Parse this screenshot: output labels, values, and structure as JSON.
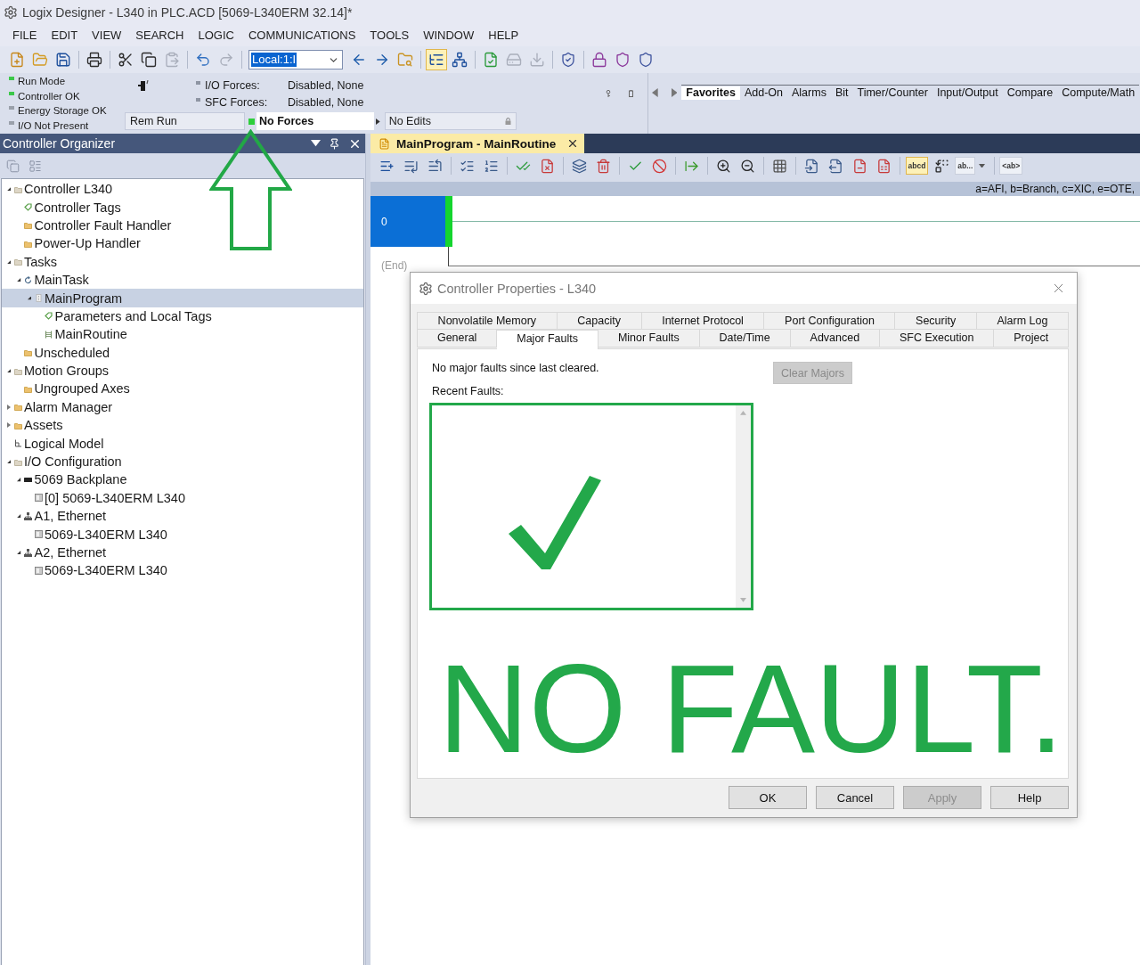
{
  "window": {
    "title": "Logix Designer - L340 in PLC.ACD [5069-L340ERM 32.14]*"
  },
  "menu": [
    "FILE",
    "EDIT",
    "VIEW",
    "SEARCH",
    "LOGIC",
    "COMMUNICATIONS",
    "TOOLS",
    "WINDOW",
    "HELP"
  ],
  "toolbar": {
    "items": [
      {
        "kind": "icon",
        "pressed": false,
        "disabled": false
      },
      {
        "kind": "icon",
        "pressed": false,
        "disabled": false
      },
      {
        "kind": "icon",
        "pressed": false,
        "disabled": false
      },
      {
        "kind": "separator"
      },
      {
        "kind": "icon",
        "pressed": false,
        "disabled": false
      },
      {
        "kind": "separator"
      },
      {
        "kind": "icon",
        "pressed": false,
        "disabled": false
      },
      {
        "kind": "icon",
        "pressed": false,
        "disabled": false
      },
      {
        "kind": "icon",
        "pressed": false,
        "disabled": true
      },
      {
        "kind": "separator"
      },
      {
        "kind": "icon",
        "pressed": false,
        "disabled": false
      },
      {
        "kind": "icon",
        "pressed": false,
        "disabled": true
      },
      {
        "kind": "separator"
      },
      {
        "kind": "field",
        "value": "Local:1:I",
        "text_selected": true
      },
      {
        "kind": "icon",
        "pressed": false,
        "disabled": false
      },
      {
        "kind": "icon",
        "pressed": false,
        "disabled": false
      },
      {
        "kind": "icon",
        "pressed": false,
        "disabled": false
      },
      {
        "kind": "separator"
      },
      {
        "kind": "icon",
        "pressed": true,
        "disabled": false
      },
      {
        "kind": "icon",
        "pressed": false,
        "disabled": false
      },
      {
        "kind": "separator"
      },
      {
        "kind": "icon",
        "pressed": false,
        "disabled": false
      },
      {
        "kind": "icon",
        "pressed": false,
        "disabled": true
      },
      {
        "kind": "icon",
        "pressed": false,
        "disabled": true
      },
      {
        "kind": "separator"
      },
      {
        "kind": "icon",
        "pressed": false,
        "disabled": false
      },
      {
        "kind": "separator"
      },
      {
        "kind": "icon",
        "pressed": false,
        "disabled": false
      },
      {
        "kind": "icon",
        "pressed": false,
        "disabled": false
      },
      {
        "kind": "icon",
        "pressed": false,
        "disabled": false
      }
    ]
  },
  "status": {
    "indicators": [
      {
        "label": "Run Mode",
        "color": "#3cc84a"
      },
      {
        "label": "Controller OK",
        "color": "#3cc84a"
      },
      {
        "label": "Energy Storage OK",
        "color": "#9aa0aa"
      },
      {
        "label": "I/O Not Present",
        "color": "#9aa0aa"
      }
    ],
    "forces": [
      {
        "label": "I/O Forces:",
        "value": "Disabled, None"
      },
      {
        "label": "SFC Forces:",
        "value": "Disabled, None"
      }
    ],
    "mode": "Rem Run",
    "forces_status": "No Forces",
    "edits_status": "No Edits"
  },
  "palette": {
    "tabs": [
      {
        "label": "Favorites",
        "selected": true
      },
      {
        "label": "Add-On",
        "selected": false
      },
      {
        "label": "Alarms",
        "selected": false
      },
      {
        "label": "Bit",
        "selected": false
      },
      {
        "label": "Timer/Counter",
        "selected": false
      },
      {
        "label": "Input/Output",
        "selected": false
      },
      {
        "label": "Compare",
        "selected": false
      },
      {
        "label": "Compute/Math",
        "selected": false
      }
    ]
  },
  "organizer": {
    "title": "Controller Organizer",
    "tree": [
      {
        "label": "Controller L340",
        "kind": "group",
        "expanded": true,
        "selected": false,
        "children": [
          {
            "label": "Controller Tags",
            "kind": "tags",
            "selected": false
          },
          {
            "label": "Controller Fault Handler",
            "kind": "folder",
            "selected": false
          },
          {
            "label": "Power-Up Handler",
            "kind": "folder",
            "selected": false
          }
        ]
      },
      {
        "label": "Tasks",
        "kind": "group",
        "expanded": true,
        "selected": false,
        "children": [
          {
            "label": "MainTask",
            "kind": "task",
            "expanded": true,
            "selected": false,
            "children": [
              {
                "label": "MainProgram",
                "kind": "program",
                "expanded": true,
                "selected": true,
                "children": [
                  {
                    "label": "Parameters and Local Tags",
                    "kind": "tags",
                    "selected": false
                  },
                  {
                    "label": "MainRoutine",
                    "kind": "routine",
                    "selected": false
                  }
                ]
              }
            ]
          },
          {
            "label": "Unscheduled",
            "kind": "folder",
            "selected": false
          }
        ]
      },
      {
        "label": "Motion Groups",
        "kind": "group",
        "expanded": true,
        "selected": false,
        "children": [
          {
            "label": "Ungrouped Axes",
            "kind": "folder",
            "selected": false
          }
        ]
      },
      {
        "label": "Alarm Manager",
        "kind": "folder",
        "expanded": false,
        "selected": false
      },
      {
        "label": "Assets",
        "kind": "folder",
        "expanded": false,
        "selected": false
      },
      {
        "label": "Logical Model",
        "kind": "model",
        "selected": false
      },
      {
        "label": "I/O Configuration",
        "kind": "group",
        "expanded": true,
        "selected": false,
        "children": [
          {
            "label": "5069 Backplane",
            "kind": "backplane",
            "expanded": true,
            "selected": false,
            "children": [
              {
                "label": "[0] 5069-L340ERM L340",
                "kind": "module",
                "selected": false
              }
            ]
          },
          {
            "label": "A1, Ethernet",
            "kind": "network",
            "expanded": true,
            "selected": false,
            "children": [
              {
                "label": "5069-L340ERM L340",
                "kind": "module",
                "selected": false
              }
            ]
          },
          {
            "label": "A2, Ethernet",
            "kind": "network",
            "expanded": true,
            "selected": false,
            "children": [
              {
                "label": "5069-L340ERM L340",
                "kind": "module",
                "selected": false
              }
            ]
          }
        ]
      }
    ]
  },
  "editor": {
    "tabs": [
      {
        "label": "MainProgram - MainRoutine",
        "selected": true
      }
    ],
    "toolbar": {
      "items": [
        {
          "kind": "icon",
          "pressed": false
        },
        {
          "kind": "icon",
          "pressed": false
        },
        {
          "kind": "icon",
          "pressed": false
        },
        {
          "kind": "separator"
        },
        {
          "kind": "icon",
          "pressed": false
        },
        {
          "kind": "icon",
          "pressed": false
        },
        {
          "kind": "separator"
        },
        {
          "kind": "icon",
          "pressed": false
        },
        {
          "kind": "icon",
          "pressed": false
        },
        {
          "kind": "separator"
        },
        {
          "kind": "icon",
          "pressed": false
        },
        {
          "kind": "icon",
          "pressed": false
        },
        {
          "kind": "separator"
        },
        {
          "kind": "icon",
          "pressed": false
        },
        {
          "kind": "icon",
          "pressed": false
        },
        {
          "kind": "separator"
        },
        {
          "kind": "icon",
          "pressed": false
        },
        {
          "kind": "separator"
        },
        {
          "kind": "icon",
          "pressed": false
        },
        {
          "kind": "icon",
          "pressed": false
        },
        {
          "kind": "separator"
        },
        {
          "kind": "icon",
          "pressed": false
        },
        {
          "kind": "separator"
        },
        {
          "kind": "icon",
          "pressed": false
        },
        {
          "kind": "icon",
          "pressed": false
        },
        {
          "kind": "icon",
          "pressed": false
        },
        {
          "kind": "icon",
          "pressed": false
        },
        {
          "kind": "separator"
        },
        {
          "kind": "text",
          "label": "abcd",
          "pressed": true
        },
        {
          "kind": "icon",
          "pressed": false
        },
        {
          "kind": "dropdown",
          "label": "ab...",
          "pressed": false
        },
        {
          "kind": "separator"
        },
        {
          "kind": "text",
          "label": "<ab>",
          "pressed": false
        }
      ]
    },
    "legend": "a=AFI, b=Branch, c=XIC, e=OTE,",
    "rungs": [
      {
        "number": "0",
        "selected": true
      }
    ],
    "end_label": "(End)"
  },
  "dialog": {
    "title": "Controller Properties - L340",
    "tab_rows": [
      [
        {
          "label": "Nonvolatile Memory",
          "selected": false
        },
        {
          "label": "Capacity",
          "selected": false
        },
        {
          "label": "Internet Protocol",
          "selected": false
        },
        {
          "label": "Port Configuration",
          "selected": false
        },
        {
          "label": "Security",
          "selected": false
        },
        {
          "label": "Alarm Log",
          "selected": false
        }
      ],
      [
        {
          "label": "General",
          "selected": false
        },
        {
          "label": "Major Faults",
          "selected": true
        },
        {
          "label": "Minor Faults",
          "selected": false
        },
        {
          "label": "Date/Time",
          "selected": false
        },
        {
          "label": "Advanced",
          "selected": false
        },
        {
          "label": "SFC Execution",
          "selected": false
        },
        {
          "label": "Project",
          "selected": false
        }
      ]
    ],
    "message": "No major faults since last cleared.",
    "clear_button": {
      "label": "Clear Majors",
      "disabled": true
    },
    "recent_label": "Recent Faults:",
    "overlay_text": "NO FAULT.",
    "buttons": [
      {
        "label": "OK",
        "disabled": false
      },
      {
        "label": "Cancel",
        "disabled": false
      },
      {
        "label": "Apply",
        "disabled": true
      },
      {
        "label": "Help",
        "disabled": false
      }
    ]
  }
}
